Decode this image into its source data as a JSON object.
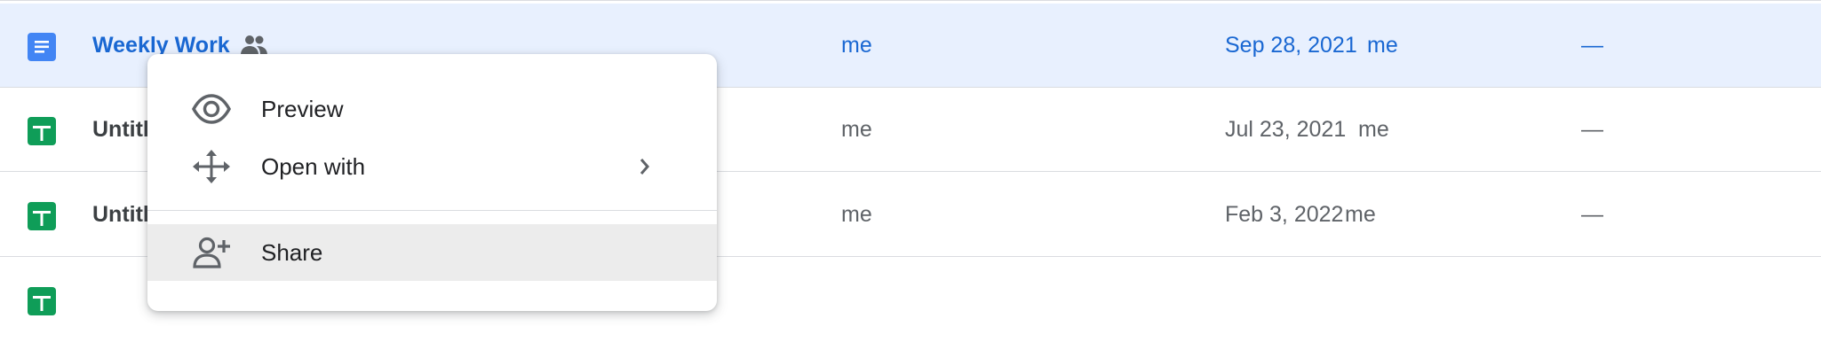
{
  "files": [
    {
      "name": "Weekly Work",
      "type": "doc",
      "shared": true,
      "owner": "me",
      "modified": "Sep 28, 2021",
      "modified_by": "me",
      "size": "—",
      "selected": true
    },
    {
      "name": "Untitl",
      "type": "sheet",
      "shared": false,
      "owner": "me",
      "modified": "Jul 23, 2021",
      "modified_by": "me",
      "size": "—",
      "selected": false
    },
    {
      "name": "Untitl",
      "type": "sheet",
      "shared": false,
      "owner": "me",
      "modified": "Feb 3, 2022",
      "modified_by": "me",
      "size": "—",
      "selected": false
    },
    {
      "name": "",
      "type": "sheet",
      "shared": false,
      "owner": "",
      "modified": "",
      "modified_by": "",
      "size": "",
      "selected": false
    }
  ],
  "context_menu": {
    "items": [
      {
        "label": "Preview",
        "icon": "eye-icon"
      },
      {
        "label": "Open with",
        "icon": "move-arrows-icon",
        "submenu": true
      },
      {
        "label": "Share",
        "icon": "person-add-icon",
        "hovered": true
      }
    ]
  },
  "colors": {
    "selected_row_bg": "#e8f0fe",
    "selected_text": "#1967d2",
    "doc_icon": "#4285f4",
    "sheet_icon": "#0f9d58",
    "hover_item_bg": "#ececec"
  }
}
